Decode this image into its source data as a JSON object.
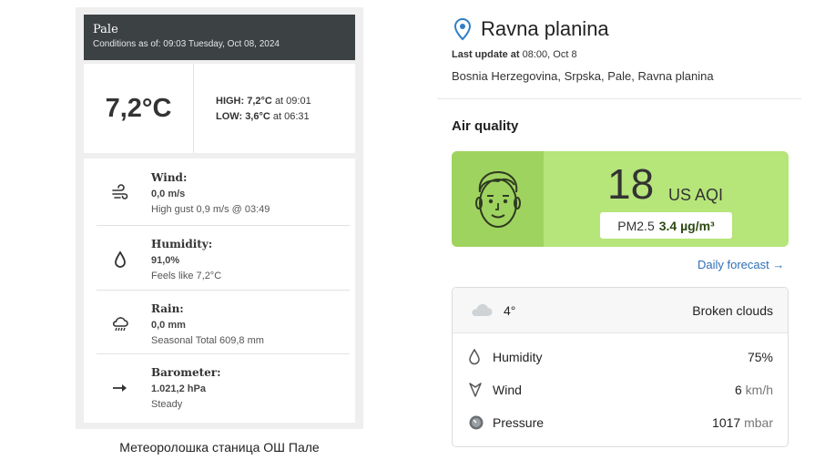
{
  "left_panel": {
    "station": "Pale",
    "conditions": "Conditions as of: 09:03 Tuesday, Oct 08, 2024",
    "temperature": "7,2°C",
    "high_label": "HIGH:",
    "high_value": "7,2°C",
    "high_time": "at 09:01",
    "low_label": "LOW:",
    "low_value": "3,6°C",
    "low_time": "at 06:31",
    "details": [
      {
        "icon": "wind-icon",
        "title": "Wind:",
        "value": "0,0 m/s",
        "sub": "High gust 0,9 m/s @ 03:49"
      },
      {
        "icon": "humidity-icon",
        "title": "Humidity:",
        "value": "91,0%",
        "sub": "Feels like 7,2°C"
      },
      {
        "icon": "rain-icon",
        "title": "Rain:",
        "value": "0,0 mm",
        "sub": "Seasonal Total 609,8 mm"
      },
      {
        "icon": "barometer-arrow-icon",
        "title": "Barometer:",
        "value": "1.021,2 hPa",
        "sub": "Steady"
      }
    ],
    "caption": "Метеоролошка станица ОШ Пале"
  },
  "right_panel": {
    "location_icon": "location-pin-icon",
    "title": "Ravna planina",
    "last_update_label": "Last update at",
    "last_update_value": "08:00, Oct 8",
    "breadcrumb": "Bosnia Herzegovina, Srpska, Pale, Ravna planina",
    "aq_heading": "Air quality",
    "aqi_value": "18",
    "aqi_unit": "US AQI",
    "pm_label": "PM2.5",
    "pm_value": "3.4 µg/m³",
    "daily_forecast": "Daily forecast →",
    "colors": {
      "aq_card": "#b6e57a",
      "aq_face": "#9fd35f",
      "link": "#2f6fb5"
    },
    "weather": {
      "icon": "cloud-icon",
      "temp": "4°",
      "condition": "Broken clouds",
      "rows": [
        {
          "icon": "drop-icon",
          "label": "Humidity",
          "value": "75%",
          "unit": ""
        },
        {
          "icon": "wind-direction-icon",
          "label": "Wind",
          "value": "6",
          "unit": "km/h"
        },
        {
          "icon": "pressure-icon",
          "label": "Pressure",
          "value": "1017",
          "unit": "mbar"
        }
      ]
    }
  }
}
